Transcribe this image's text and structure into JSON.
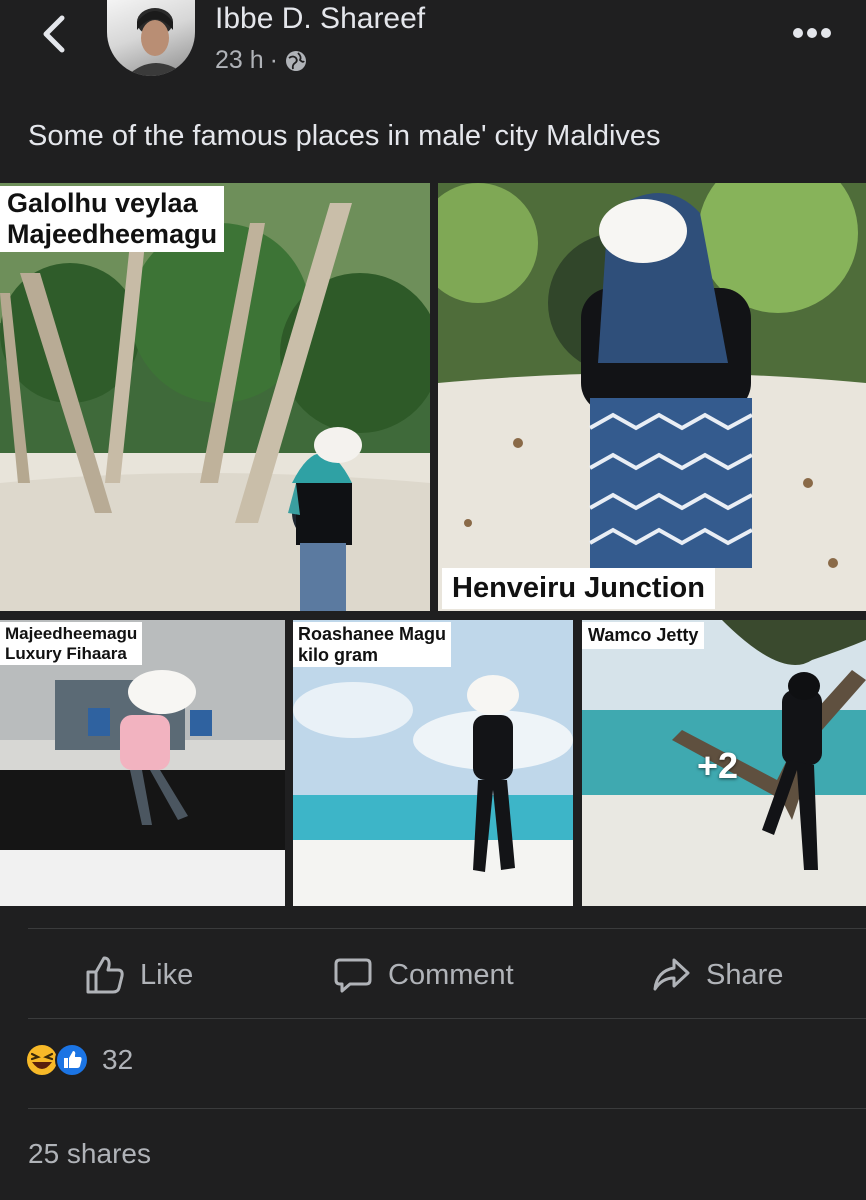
{
  "post": {
    "author": "Ibbe D. Shareef",
    "time": "23 h",
    "separator": "·",
    "caption": "Some of the famous places in male' city Maldives"
  },
  "photos": [
    {
      "label": "Galolhu veylaa\nMajeedheemagu"
    },
    {
      "label": "Henveiru Junction"
    },
    {
      "label": "Majeedheemagu\nLuxury Fihaara"
    },
    {
      "label": "Roashanee Magu\nkilo gram"
    },
    {
      "label": "Wamco Jetty",
      "more": "+2"
    }
  ],
  "actions": {
    "like": "Like",
    "comment": "Comment",
    "share": "Share"
  },
  "reactions": {
    "count": "32",
    "types": [
      "haha-icon",
      "like-icon"
    ]
  },
  "shares": "25 shares",
  "colors": {
    "background": "#1f1f20",
    "text": "#e4e6eb",
    "secondary": "#b0b3b8",
    "like_blue": "#1b74e4",
    "haha_yellow": "#f7b928"
  }
}
